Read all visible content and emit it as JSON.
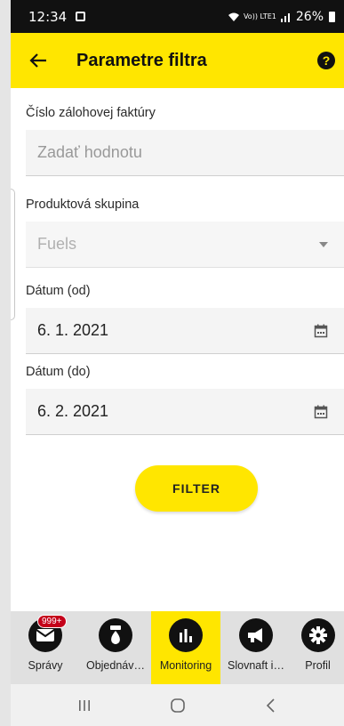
{
  "status_bar": {
    "time": "12:34",
    "network": "Vo)) LTE1",
    "battery": "26%"
  },
  "app_bar": {
    "title": "Parametre filtra"
  },
  "form": {
    "invoice_label": "Číslo zálohovej faktúry",
    "invoice_placeholder": "Zadať hodnotu",
    "group_label": "Produktová skupina",
    "group_value": "Fuels",
    "date_from_label": "Dátum (od)",
    "date_from_value": "6. 1. 2021",
    "date_to_label": "Dátum (do)",
    "date_to_value": "6. 2. 2021",
    "filter_button": "FILTER"
  },
  "bottom_nav": {
    "items": [
      {
        "label": "Správy",
        "icon": "mail-icon",
        "badge": "999+"
      },
      {
        "label": "Objednáv…",
        "icon": "fuel-drop-icon"
      },
      {
        "label": "Monitoring",
        "icon": "bar-chart-icon",
        "active": true
      },
      {
        "label": "Slovnaft i…",
        "icon": "megaphone-icon"
      },
      {
        "label": "Profil",
        "icon": "gear-icon"
      }
    ]
  },
  "colors": {
    "accent": "#ffe600",
    "badge": "#c4001a"
  }
}
